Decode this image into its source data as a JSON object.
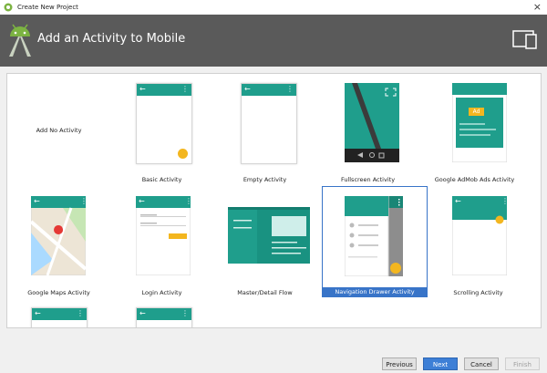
{
  "window": {
    "title": "Create New Project",
    "close_glyph": "×"
  },
  "header": {
    "title": "Add an Activity to Mobile",
    "icon": "android-studio-icon",
    "device_icon": "phone-tablet-icon"
  },
  "templates": [
    {
      "label": "Add No Activity"
    },
    {
      "label": "Basic Activity"
    },
    {
      "label": "Empty Activity"
    },
    {
      "label": "Fullscreen Activity"
    },
    {
      "label": "Google AdMob Ads Activity",
      "ad_text": "Ad"
    },
    {
      "label": "Google Maps Activity"
    },
    {
      "label": "Login Activity"
    },
    {
      "label": "Master/Detail Flow"
    },
    {
      "label": "Navigation Drawer Activity",
      "selected": true
    },
    {
      "label": "Scrolling Activity"
    }
  ],
  "footer": {
    "previous": "Previous",
    "next": "Next",
    "cancel": "Cancel",
    "finish": "Finish"
  },
  "colors": {
    "accent": "#1f9e8c",
    "header": "#5a5a5a",
    "selection": "#3874c8",
    "fab": "#f3b61f"
  }
}
